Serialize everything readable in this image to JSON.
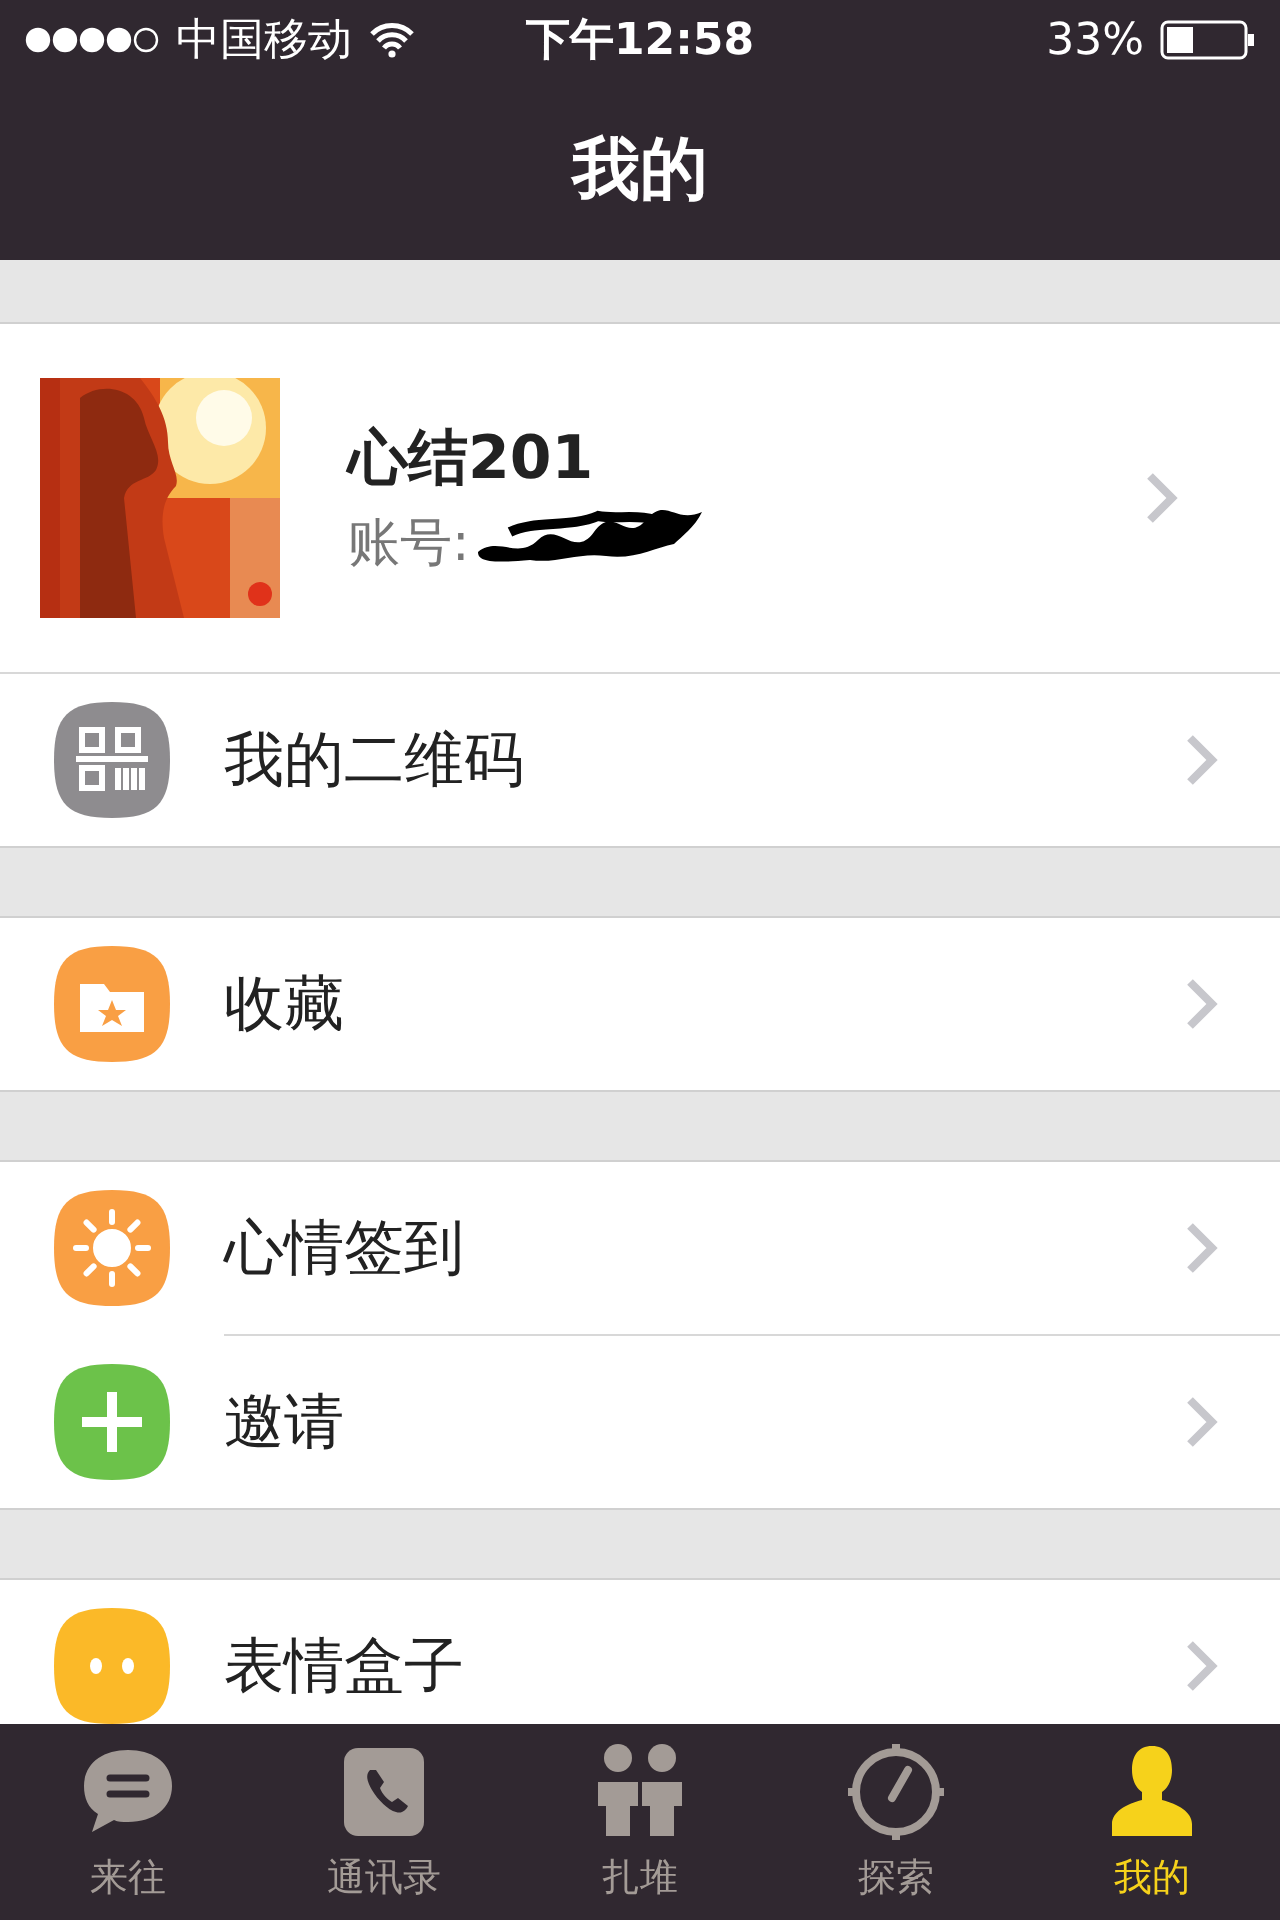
{
  "status_bar": {
    "carrier": "中国移动",
    "time": "下午12:58",
    "battery": "33%"
  },
  "nav_bar": {
    "title": "我的"
  },
  "profile": {
    "name": "心结201",
    "account_label": "账号:",
    "account_redacted": true
  },
  "sections": [
    [
      {
        "kind": "qr",
        "label": "我的二维码",
        "color": "#8e8c8f"
      }
    ],
    [
      {
        "kind": "folder",
        "label": "收藏",
        "color": "#f99f44"
      }
    ],
    [
      {
        "kind": "sun",
        "label": "心情签到",
        "color": "#f99f44"
      },
      {
        "kind": "plus",
        "label": "邀请",
        "color": "#6cc24a"
      }
    ],
    [
      {
        "kind": "face",
        "label": "表情盒子",
        "color": "#fbb928"
      }
    ]
  ],
  "tabs": [
    {
      "kind": "chat",
      "label": "来往",
      "selected": false
    },
    {
      "kind": "contacts",
      "label": "通讯录",
      "selected": false
    },
    {
      "kind": "group",
      "label": "扎堆",
      "selected": false
    },
    {
      "kind": "compass",
      "label": "探索",
      "selected": false
    },
    {
      "kind": "person",
      "label": "我的",
      "selected": true
    }
  ]
}
